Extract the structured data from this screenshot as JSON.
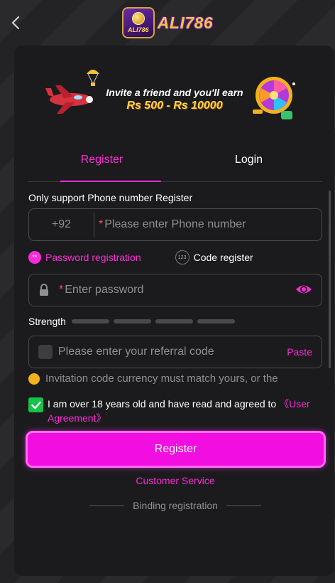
{
  "header": {
    "logo_text": "ALI786",
    "logo_badge_text": "ALI786"
  },
  "banner": {
    "line1": "Invite a friend and you'll earn",
    "line2": "Rs 500 - Rs 10000"
  },
  "tabs": [
    {
      "label": "Register",
      "active": true
    },
    {
      "label": "Login",
      "active": false
    }
  ],
  "form": {
    "support_label": "Only support Phone number Register",
    "phone_prefix": "+92",
    "phone_placeholder": "Please enter Phone number",
    "required_mark": "*",
    "options": {
      "password": "Password registration",
      "password_icon": "**",
      "code": "Code register",
      "code_icon": "123"
    },
    "password_placeholder": "Enter password",
    "strength_label": "Strength",
    "referral_placeholder": "Please enter your referral code",
    "paste_label": "Paste",
    "notice": "Invitation code currency must match yours, or the",
    "agree_text": "I am over 18 years old and have read and agreed to ",
    "agree_link": "《User Agreement》",
    "agree_checked": true
  },
  "actions": {
    "register_button": "Register",
    "customer_service": "Customer Service",
    "binding_registration": "Binding registration"
  },
  "colors": {
    "accent": "#ff2bd7",
    "button": "#f20ee0",
    "check": "#16c24a",
    "background": "#1b1b1d"
  }
}
